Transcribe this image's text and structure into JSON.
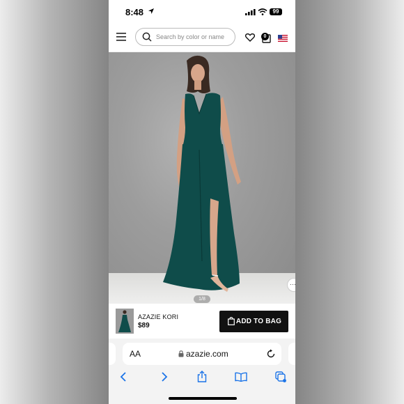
{
  "status_bar": {
    "time": "8:48",
    "battery": "99"
  },
  "header": {
    "search_placeholder": "Search by color or name",
    "bag_count": "0"
  },
  "product_image": {
    "counter": "1/8"
  },
  "product": {
    "name": "AZAZIE KORI",
    "price": "$89",
    "add_to_bag_label": "ADD TO BAG"
  },
  "browser": {
    "text_size_label": "AA",
    "url": "azazie.com"
  },
  "colors": {
    "dress": "#0f4c4a",
    "button": "#111111",
    "link_blue": "#1a73e8"
  },
  "icons": [
    "menu-icon",
    "search-icon",
    "heart-icon",
    "bag-icon",
    "flag-icon",
    "back-icon",
    "forward-icon",
    "share-icon",
    "bookmarks-icon",
    "tabs-icon"
  ]
}
